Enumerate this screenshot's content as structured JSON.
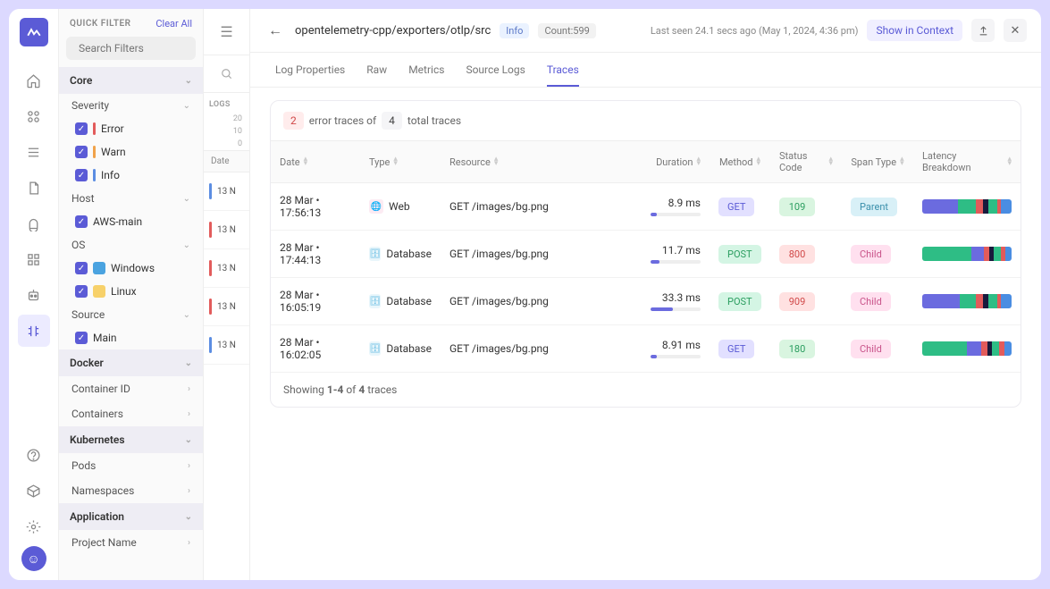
{
  "iconbar": {
    "items": [
      "home",
      "apps",
      "list",
      "file",
      "bell",
      "grid",
      "bot",
      "traces"
    ],
    "bottom": [
      "help",
      "box",
      "gear"
    ]
  },
  "sidebar": {
    "title": "QUICK FILTER",
    "clear": "Clear All",
    "search_placeholder": "Search Filters",
    "core": {
      "label": "Core",
      "severity": {
        "label": "Severity",
        "items": [
          {
            "label": "Error",
            "color": "#e25b5b"
          },
          {
            "label": "Warn",
            "color": "#f0a24a"
          },
          {
            "label": "Info",
            "color": "#5b8de2"
          }
        ]
      },
      "host": {
        "label": "Host",
        "items": [
          {
            "label": "AWS-main"
          }
        ]
      },
      "os": {
        "label": "OS",
        "items": [
          {
            "label": "Windows",
            "icon_bg": "#4aa3e0"
          },
          {
            "label": "Linux",
            "icon_bg": "#f7d16a"
          }
        ]
      },
      "source": {
        "label": "Source",
        "items": [
          {
            "label": "Main"
          }
        ]
      }
    },
    "docker": {
      "label": "Docker",
      "items": [
        "Container ID",
        "Containers"
      ]
    },
    "kubernetes": {
      "label": "Kubernetes",
      "items": [
        "Pods",
        "Namespaces"
      ]
    },
    "application": {
      "label": "Application",
      "items": [
        "Project Name"
      ]
    }
  },
  "midcol": {
    "logs_label": "LOGS",
    "yaxis": [
      "20",
      "10",
      "0"
    ],
    "date_hdr": "Date",
    "stubs": [
      {
        "text": "13 N",
        "color": "#5b8de2"
      },
      {
        "text": "13 N",
        "color": "#e25b5b"
      },
      {
        "text": "13 N",
        "color": "#e25b5b"
      },
      {
        "text": "13 N",
        "color": "#e25b5b"
      },
      {
        "text": "13 N",
        "color": "#5b8de2"
      }
    ]
  },
  "header": {
    "path": "opentelemetry-cpp/exporters/otlp/src",
    "info": "Info",
    "count": "Count:599",
    "last_seen": "Last seen 24.1 secs ago (May 1, 2024, 4:36 pm)",
    "show_context": "Show in Context"
  },
  "tabs": [
    "Log Properties",
    "Raw",
    "Metrics",
    "Source Logs",
    "Traces"
  ],
  "active_tab": 4,
  "summary": {
    "err_count": "2",
    "err_text": "error traces of",
    "total_count": "4",
    "total_text": "total traces"
  },
  "columns": [
    "Date",
    "Type",
    "Resource",
    "Duration",
    "Method",
    "Status Code",
    "Span Type",
    "Latency Breakdown"
  ],
  "rows": [
    {
      "date": "28 Mar • 17:56:13",
      "type": "Web",
      "type_color": "#e86aa6",
      "resource": "GET /images/bg.png",
      "duration": "8.9 ms",
      "dur_pct": 12,
      "method": "GET",
      "code": "109",
      "code_class": "code-g",
      "span": "Parent",
      "span_class": "parent",
      "lat": [
        [
          "#6b6bdf",
          40
        ],
        [
          "#2ebd85",
          20
        ],
        [
          "#e25b5b",
          8
        ],
        [
          "#1a1a3d",
          6
        ],
        [
          "#2ebd85",
          10
        ],
        [
          "#e25b5b",
          4
        ],
        [
          "#4a8de2",
          12
        ]
      ]
    },
    {
      "date": "28 Mar • 17:44:13",
      "type": "Database",
      "type_color": "#5bb8e2",
      "resource": "GET /images/bg.png",
      "duration": "11.7 ms",
      "dur_pct": 18,
      "method": "POST",
      "code": "800",
      "code_class": "code-r",
      "span": "Child",
      "span_class": "child",
      "lat": [
        [
          "#2ebd85",
          55
        ],
        [
          "#6b6bdf",
          14
        ],
        [
          "#e25b5b",
          6
        ],
        [
          "#1a1a3d",
          5
        ],
        [
          "#2ebd85",
          8
        ],
        [
          "#e25b5b",
          5
        ],
        [
          "#4a8de2",
          7
        ]
      ]
    },
    {
      "date": "28 Mar • 16:05:19",
      "type": "Database",
      "type_color": "#5bb8e2",
      "resource": "GET /images/bg.png",
      "duration": "33.3 ms",
      "dur_pct": 45,
      "method": "POST",
      "code": "909",
      "code_class": "code-r",
      "span": "Child",
      "span_class": "child",
      "lat": [
        [
          "#6b6bdf",
          42
        ],
        [
          "#2ebd85",
          18
        ],
        [
          "#e25b5b",
          8
        ],
        [
          "#1a1a3d",
          6
        ],
        [
          "#2ebd85",
          10
        ],
        [
          "#e25b5b",
          4
        ],
        [
          "#4a8de2",
          12
        ]
      ]
    },
    {
      "date": "28 Mar • 16:02:05",
      "type": "Database",
      "type_color": "#5bb8e2",
      "resource": "GET /images/bg.png",
      "duration": "8.91 ms",
      "dur_pct": 12,
      "method": "GET",
      "code": "180",
      "code_class": "code-g",
      "span": "Child",
      "span_class": "child",
      "lat": [
        [
          "#2ebd85",
          50
        ],
        [
          "#6b6bdf",
          16
        ],
        [
          "#e25b5b",
          7
        ],
        [
          "#1a1a3d",
          5
        ],
        [
          "#2ebd85",
          8
        ],
        [
          "#e25b5b",
          6
        ],
        [
          "#4a8de2",
          8
        ]
      ]
    }
  ],
  "footer": {
    "prefix": "Showing ",
    "range": "1-4",
    "mid": " of ",
    "total": "4",
    "suffix": " traces"
  }
}
